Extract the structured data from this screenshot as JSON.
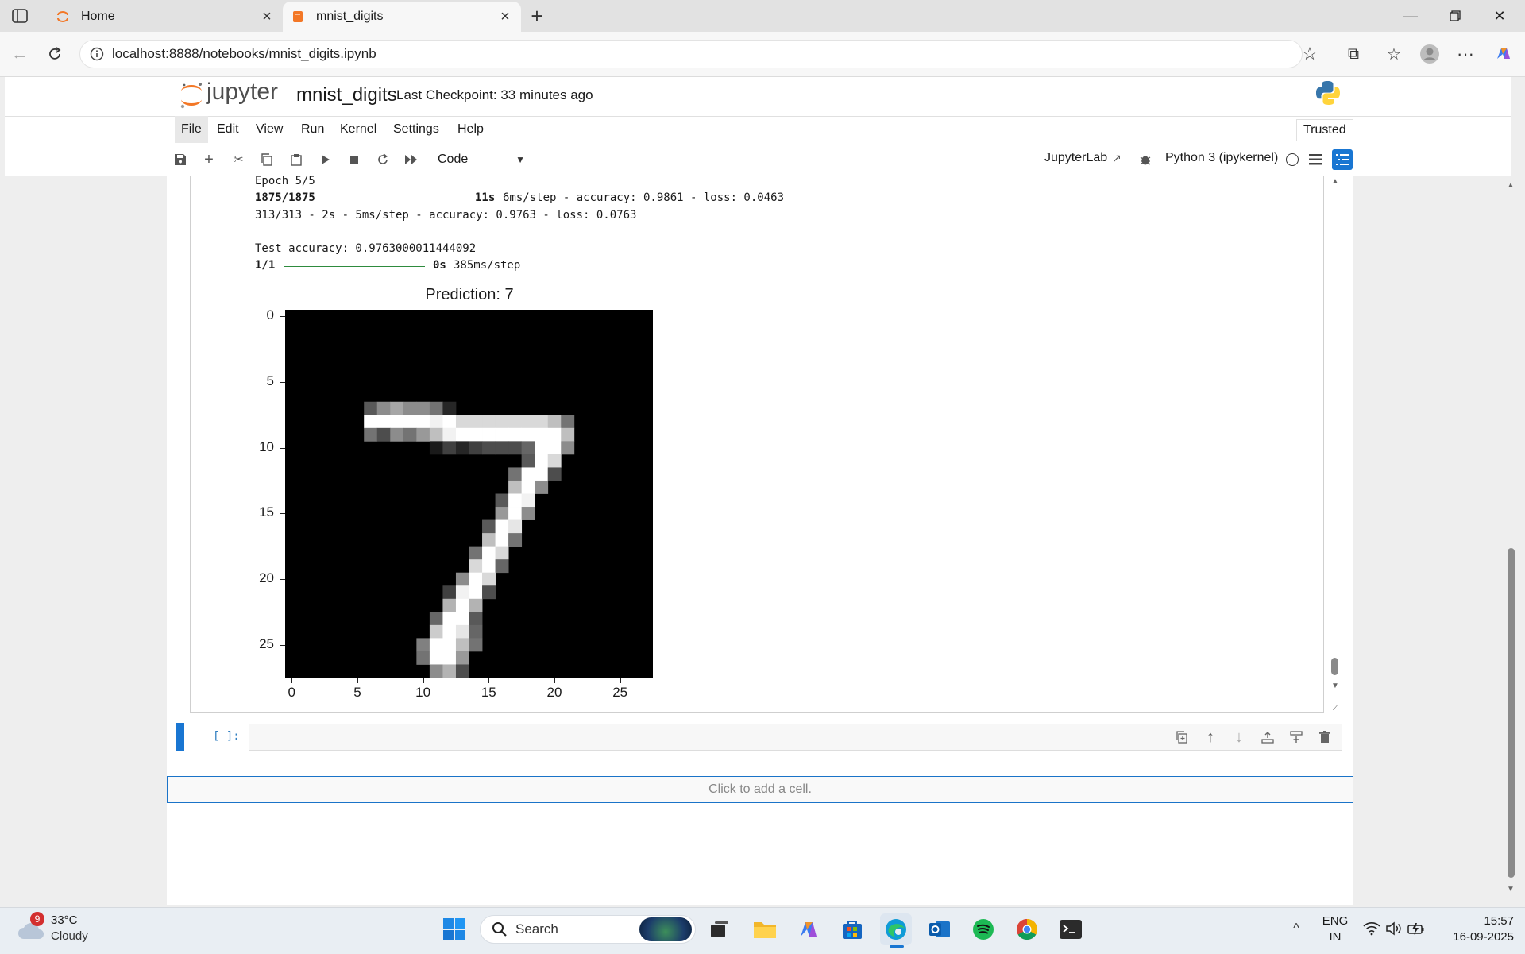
{
  "browser": {
    "tabs": [
      {
        "title": "Home",
        "active": false
      },
      {
        "title": "mnist_digits",
        "active": true
      }
    ],
    "url": "localhost:8888/notebooks/mnist_digits.ipynb"
  },
  "jupyter": {
    "logo_text": "jupyter",
    "notebook_name": "mnist_digits",
    "checkpoint": "Last Checkpoint: 33 minutes ago",
    "menu": [
      "File",
      "Edit",
      "View",
      "Run",
      "Kernel",
      "Settings",
      "Help"
    ],
    "trusted": "Trusted",
    "cell_type": "Code",
    "jupyterlab_link": "JupyterLab",
    "kernel": "Python 3 (ipykernel)"
  },
  "output": {
    "lines": [
      {
        "plain": "Epoch 5/5"
      },
      {
        "bold_a": "1875/1875",
        "bold_b": "11s",
        "rest": "6ms/step - accuracy: 0.9861 - loss: 0.0463"
      },
      {
        "plain": "313/313 - 2s - 5ms/step - accuracy: 0.9763 - loss: 0.0763"
      },
      {
        "plain": "Test accuracy: 0.9763000011444092"
      },
      {
        "bold_a": "1/1",
        "bold_b": "0s",
        "rest": "385ms/step"
      }
    ],
    "figure": {
      "title": "Prediction: 7",
      "y_ticks": [
        "0",
        "5",
        "10",
        "15",
        "20",
        "25"
      ],
      "x_ticks": [
        "0",
        "5",
        "10",
        "15",
        "20",
        "25"
      ]
    }
  },
  "chart_data": {
    "type": "heatmap",
    "title": "Prediction: 7",
    "xlim": [
      -0.5,
      27.5
    ],
    "ylim": [
      27.5,
      -0.5
    ],
    "cmap": "gray",
    "x_ticks": [
      0,
      5,
      10,
      15,
      20,
      25
    ],
    "y_ticks": [
      0,
      5,
      10,
      15,
      20,
      25
    ],
    "cells": [
      [
        7,
        6,
        0.35
      ],
      [
        7,
        7,
        0.55
      ],
      [
        7,
        8,
        0.65
      ],
      [
        7,
        9,
        0.55
      ],
      [
        7,
        10,
        0.55
      ],
      [
        7,
        11,
        0.45
      ],
      [
        7,
        12,
        0.15
      ],
      [
        8,
        6,
        1.0
      ],
      [
        8,
        7,
        1.0
      ],
      [
        8,
        8,
        1.0
      ],
      [
        8,
        9,
        1.0
      ],
      [
        8,
        10,
        1.0
      ],
      [
        8,
        11,
        0.95
      ],
      [
        8,
        12,
        1.0
      ],
      [
        8,
        13,
        0.85
      ],
      [
        8,
        14,
        0.85
      ],
      [
        8,
        15,
        0.85
      ],
      [
        8,
        16,
        0.85
      ],
      [
        8,
        17,
        0.85
      ],
      [
        8,
        18,
        0.85
      ],
      [
        8,
        19,
        0.85
      ],
      [
        8,
        20,
        0.75
      ],
      [
        8,
        21,
        0.45
      ],
      [
        9,
        6,
        0.45
      ],
      [
        9,
        7,
        0.3
      ],
      [
        9,
        8,
        0.55
      ],
      [
        9,
        9,
        0.45
      ],
      [
        9,
        10,
        0.6
      ],
      [
        9,
        11,
        0.75
      ],
      [
        9,
        12,
        0.95
      ],
      [
        9,
        13,
        1.0
      ],
      [
        9,
        14,
        1.0
      ],
      [
        9,
        15,
        1.0
      ],
      [
        9,
        16,
        1.0
      ],
      [
        9,
        17,
        1.0
      ],
      [
        9,
        18,
        1.0
      ],
      [
        9,
        19,
        1.0
      ],
      [
        9,
        20,
        1.0
      ],
      [
        9,
        21,
        0.75
      ],
      [
        10,
        11,
        0.1
      ],
      [
        10,
        12,
        0.25
      ],
      [
        10,
        13,
        0.15
      ],
      [
        10,
        14,
        0.25
      ],
      [
        10,
        15,
        0.3
      ],
      [
        10,
        16,
        0.3
      ],
      [
        10,
        17,
        0.3
      ],
      [
        10,
        18,
        0.4
      ],
      [
        10,
        19,
        1.0
      ],
      [
        10,
        20,
        1.0
      ],
      [
        10,
        21,
        0.55
      ],
      [
        11,
        18,
        0.35
      ],
      [
        11,
        19,
        1.0
      ],
      [
        11,
        20,
        0.85
      ],
      [
        12,
        17,
        0.45
      ],
      [
        12,
        18,
        1.0
      ],
      [
        12,
        19,
        1.0
      ],
      [
        12,
        20,
        0.3
      ],
      [
        13,
        17,
        0.75
      ],
      [
        13,
        18,
        1.0
      ],
      [
        13,
        19,
        0.55
      ],
      [
        14,
        16,
        0.35
      ],
      [
        14,
        17,
        1.0
      ],
      [
        14,
        18,
        0.95
      ],
      [
        15,
        16,
        0.6
      ],
      [
        15,
        17,
        1.0
      ],
      [
        15,
        18,
        0.55
      ],
      [
        16,
        15,
        0.35
      ],
      [
        16,
        16,
        1.0
      ],
      [
        16,
        17,
        0.9
      ],
      [
        17,
        15,
        0.75
      ],
      [
        17,
        16,
        1.0
      ],
      [
        17,
        17,
        0.45
      ],
      [
        18,
        14,
        0.45
      ],
      [
        18,
        15,
        1.0
      ],
      [
        18,
        16,
        0.85
      ],
      [
        19,
        14,
        0.85
      ],
      [
        19,
        15,
        1.0
      ],
      [
        19,
        16,
        0.4
      ],
      [
        20,
        13,
        0.55
      ],
      [
        20,
        14,
        1.0
      ],
      [
        20,
        15,
        0.85
      ],
      [
        21,
        12,
        0.25
      ],
      [
        21,
        13,
        0.95
      ],
      [
        21,
        14,
        1.0
      ],
      [
        21,
        15,
        0.3
      ],
      [
        22,
        12,
        0.7
      ],
      [
        22,
        13,
        1.0
      ],
      [
        22,
        14,
        0.7
      ],
      [
        23,
        11,
        0.4
      ],
      [
        23,
        12,
        1.0
      ],
      [
        23,
        13,
        1.0
      ],
      [
        23,
        14,
        0.35
      ],
      [
        24,
        11,
        0.8
      ],
      [
        24,
        12,
        1.0
      ],
      [
        24,
        13,
        0.9
      ],
      [
        24,
        14,
        0.4
      ],
      [
        25,
        10,
        0.5
      ],
      [
        25,
        11,
        1.0
      ],
      [
        25,
        12,
        1.0
      ],
      [
        25,
        13,
        0.75
      ],
      [
        25,
        14,
        0.45
      ],
      [
        26,
        10,
        0.45
      ],
      [
        26,
        11,
        1.0
      ],
      [
        26,
        12,
        1.0
      ],
      [
        26,
        13,
        0.6
      ],
      [
        27,
        11,
        0.55
      ],
      [
        27,
        12,
        0.7
      ],
      [
        27,
        13,
        0.3
      ]
    ]
  },
  "empty_cell": {
    "prompt": "[ ]:"
  },
  "add_cell": "Click to add a cell.",
  "taskbar": {
    "weather_temp": "33°C",
    "weather_desc": "Cloudy",
    "weather_badge": "9",
    "search_label": "Search",
    "lang_top": "ENG",
    "lang_bottom": "IN",
    "time": "15:57",
    "date": "16-09-2025"
  },
  "colors": {
    "jupyter_orange": "#f37726",
    "progress_green": "#2e8b3e",
    "accent_blue": "#1976d2"
  }
}
